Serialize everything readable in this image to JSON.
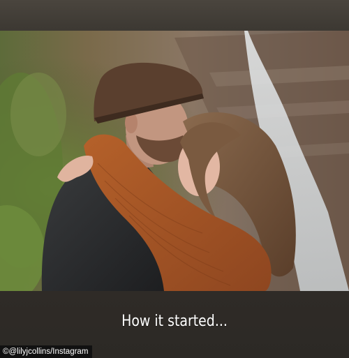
{
  "story": {
    "caption": "How it started...",
    "credit": "©@lilyjcollins/Instagram"
  },
  "photo": {
    "description_icon": "photo-image"
  },
  "colors": {
    "background": "#3a3631",
    "caption_text": "#ffffff",
    "credit_background": "#111111"
  }
}
